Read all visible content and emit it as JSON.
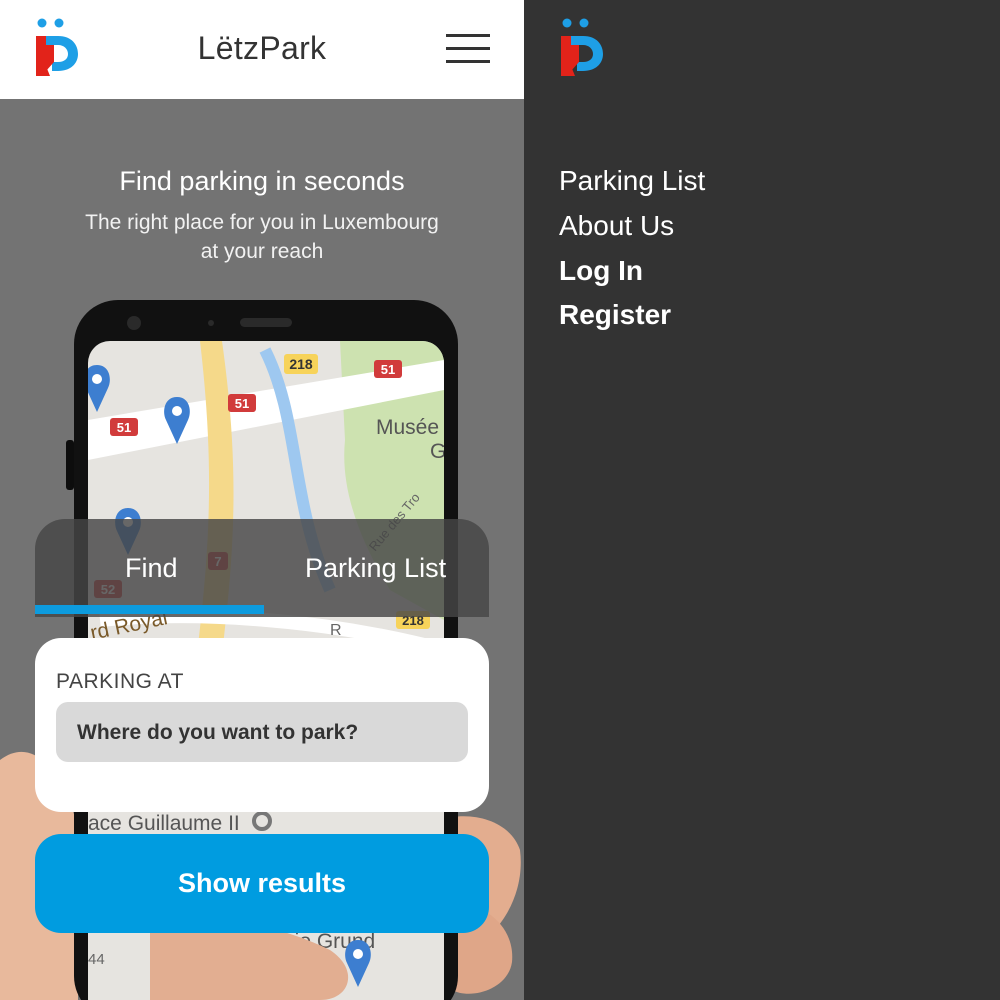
{
  "header": {
    "title": "LëtzPark",
    "logo_icon": "letzpark-logo",
    "menu_icon": "hamburger-icon"
  },
  "hero": {
    "title": "Find parking in seconds",
    "subtitle_line1": "The right place for you in Luxembourg",
    "subtitle_line2": "at your reach"
  },
  "map": {
    "road_labels": [
      "218",
      "51",
      "51",
      "51",
      "7",
      "52",
      "218"
    ],
    "place_labels": [
      "Musée",
      "G",
      "Rue des Tro",
      "rd Royal",
      "R",
      "ace Guillaume II",
      "Barrio Grund",
      "44"
    ]
  },
  "tabs": {
    "find": "Find",
    "parking_list": "Parking List",
    "active": "Find"
  },
  "form": {
    "label": "PARKING AT",
    "placeholder": "Where do you want to park?"
  },
  "actions": {
    "show_results": "Show results"
  },
  "drawer": {
    "items": [
      {
        "label": "Parking List",
        "bold": false
      },
      {
        "label": "About Us",
        "bold": false
      },
      {
        "label": "Log In",
        "bold": true
      },
      {
        "label": "Register",
        "bold": true
      }
    ]
  },
  "colors": {
    "accent": "#009ce0",
    "logo_red": "#e2231a",
    "logo_blue": "#1e9fe6",
    "drawer_bg": "#333333",
    "hero_bg": "#737373"
  }
}
